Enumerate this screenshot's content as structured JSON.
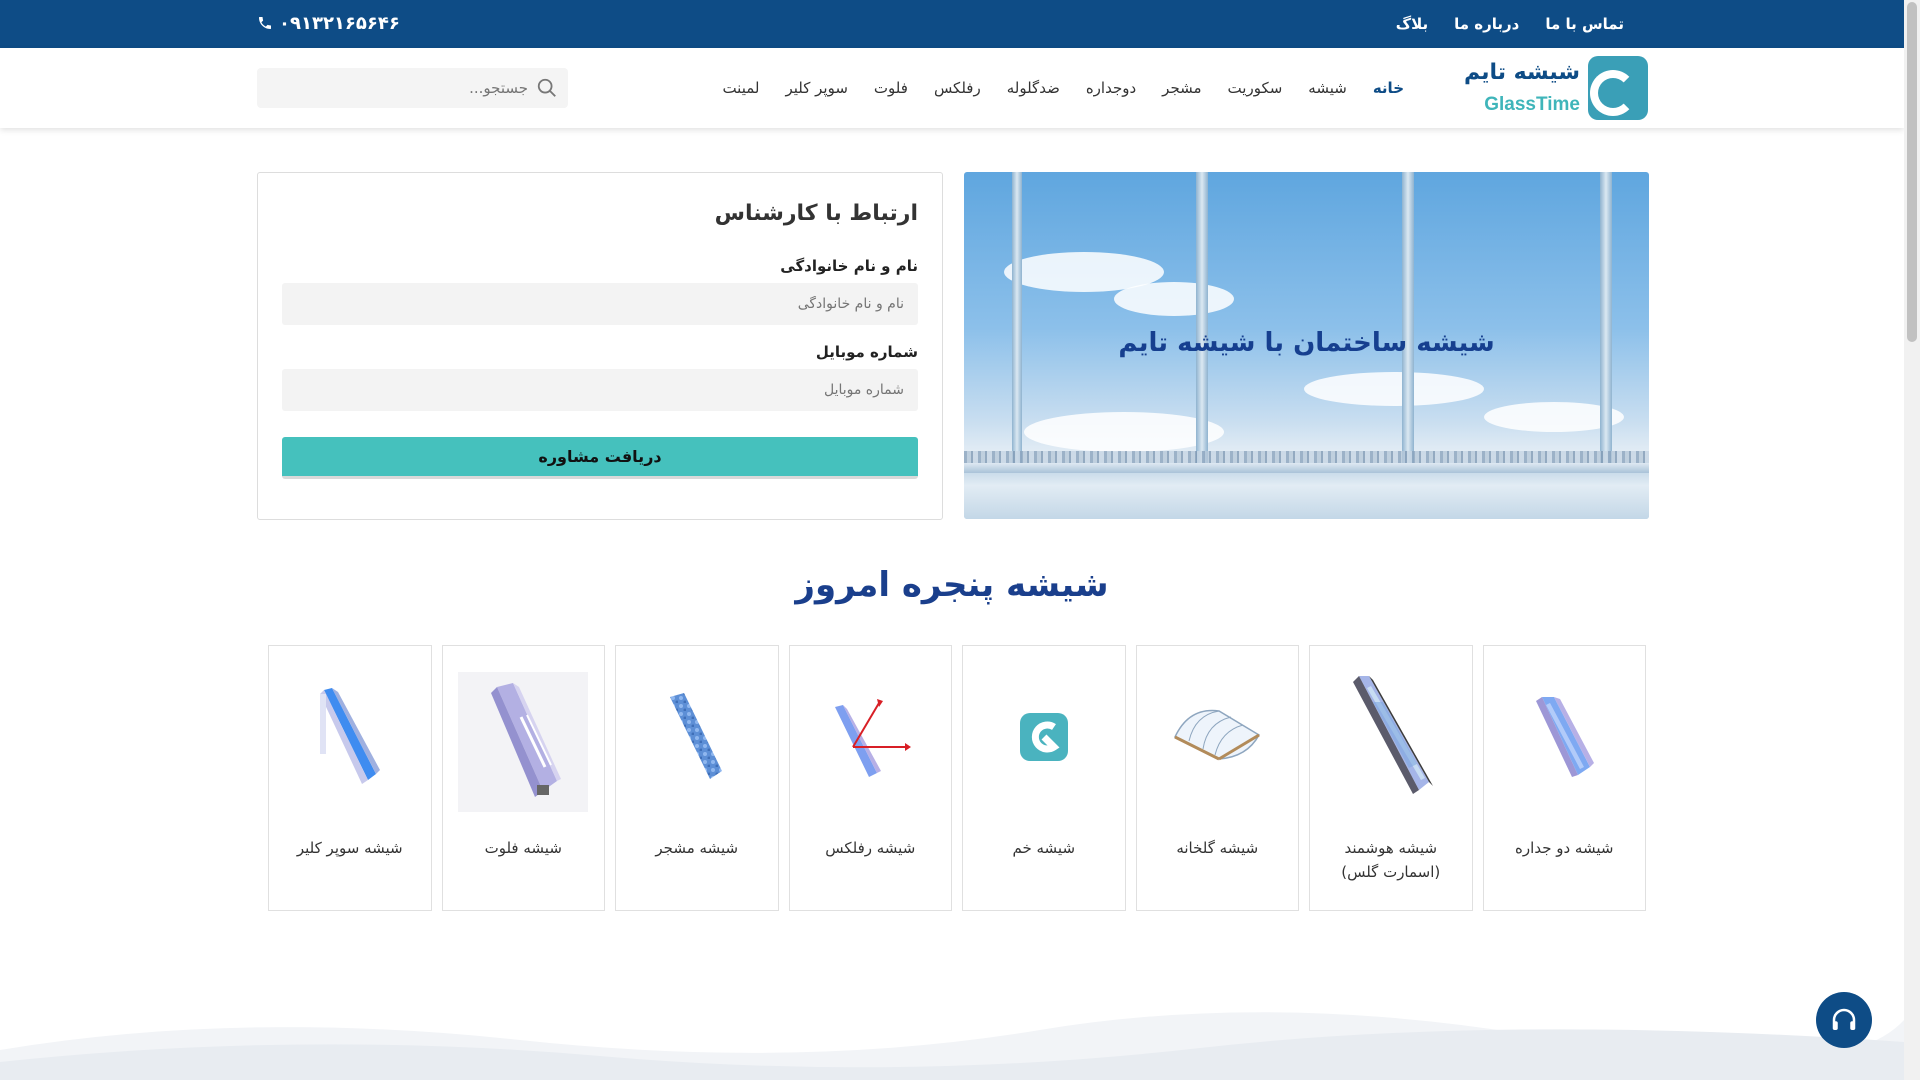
{
  "topbar": {
    "links": [
      "تماس با ما",
      "درباره ما",
      "بلاگ"
    ],
    "phone": "۰۹۱۳۲۱۶۵۶۴۶"
  },
  "header": {
    "logo_fa": "شیشه تایم",
    "logo_en": "GlassTime",
    "nav": [
      "خانه",
      "شیشه",
      "سکوریت",
      "مشجر",
      "دوجداره",
      "ضدگلوله",
      "رفلکس",
      "فلوت",
      "سوپر کلیر",
      "لمینت"
    ],
    "search_placeholder": "جستجو..."
  },
  "form": {
    "title": "ارتباط با کارشناس",
    "name_label": "نام و نام خانوادگی",
    "name_placeholder": "نام و نام خانوادگی",
    "mobile_label": "شماره موبایل",
    "mobile_placeholder": "شماره موبایل",
    "submit": "دریافت مشاوره"
  },
  "banner": {
    "title": "شیشه ساختمان با شیشه تایم"
  },
  "section": {
    "title": "شیشه پنجره امروز"
  },
  "products": [
    {
      "name": "شیشه دو جداره",
      "icon": "double-glazed-icon"
    },
    {
      "name": "شیشه هوشمند (اسمارت گلس)",
      "icon": "smart-glass-icon"
    },
    {
      "name": "شیشه گلخانه",
      "icon": "greenhouse-icon"
    },
    {
      "name": "شیشه خم",
      "icon": "curved-glass-logo-icon"
    },
    {
      "name": "شیشه رفلکس",
      "icon": "reflective-glass-icon"
    },
    {
      "name": "شیشه مشجر",
      "icon": "patterned-glass-icon"
    },
    {
      "name": "شیشه فلوت",
      "icon": "float-glass-icon"
    },
    {
      "name": "شیشه سوپر کلیر",
      "icon": "super-clear-glass-icon"
    }
  ],
  "colors": {
    "primary": "#0e4c86",
    "accent": "#45c1bd",
    "heading": "#1a3f8c"
  }
}
